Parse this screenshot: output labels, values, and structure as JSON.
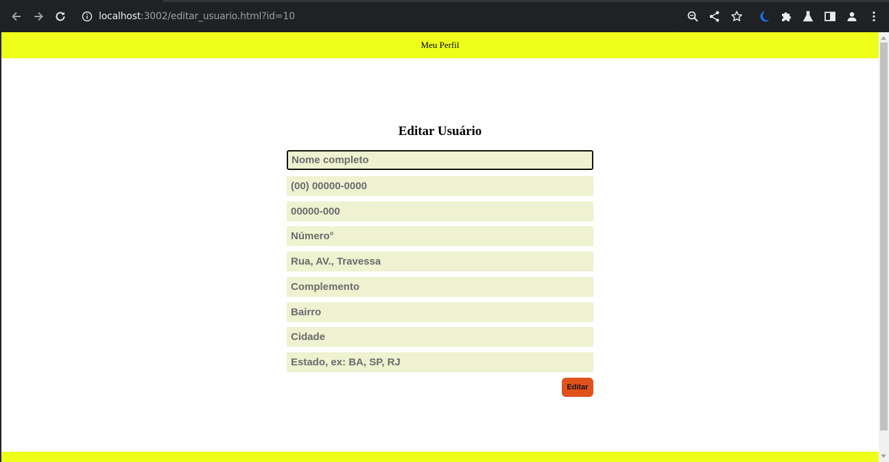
{
  "browser": {
    "url_host": "localhost",
    "url_path": ":3002/editar_usuario.html?id=10",
    "icons": [
      "back-icon",
      "forward-icon",
      "reload-icon",
      "info-icon",
      "zoom-icon",
      "share-icon",
      "star-icon",
      "moon-extension-icon",
      "puzzle-extensions-icon",
      "labs-flask-icon",
      "side-panel-icon",
      "profile-icon",
      "menu-dots-icon"
    ]
  },
  "header": {
    "link_label": "Meu Perfil",
    "color": "#eeff1a"
  },
  "form": {
    "title": "Editar Usuário",
    "fields": [
      {
        "name": "nome",
        "placeholder": "Nome completo",
        "value": ""
      },
      {
        "name": "telefone",
        "placeholder": "(00) 00000-0000",
        "value": ""
      },
      {
        "name": "cep",
        "placeholder": "00000-000",
        "value": ""
      },
      {
        "name": "numero",
        "placeholder": "Número°",
        "value": ""
      },
      {
        "name": "rua",
        "placeholder": "Rua, AV., Travessa",
        "value": ""
      },
      {
        "name": "complemento",
        "placeholder": "Complemento",
        "value": ""
      },
      {
        "name": "bairro",
        "placeholder": "Bairro",
        "value": ""
      },
      {
        "name": "cidade",
        "placeholder": "Cidade",
        "value": ""
      },
      {
        "name": "estado",
        "placeholder": "Estado, ex: BA, SP, RJ",
        "value": ""
      }
    ],
    "submit_label": "Editar",
    "field_bg": "#eef2d0",
    "button_color": "#e0521a"
  }
}
